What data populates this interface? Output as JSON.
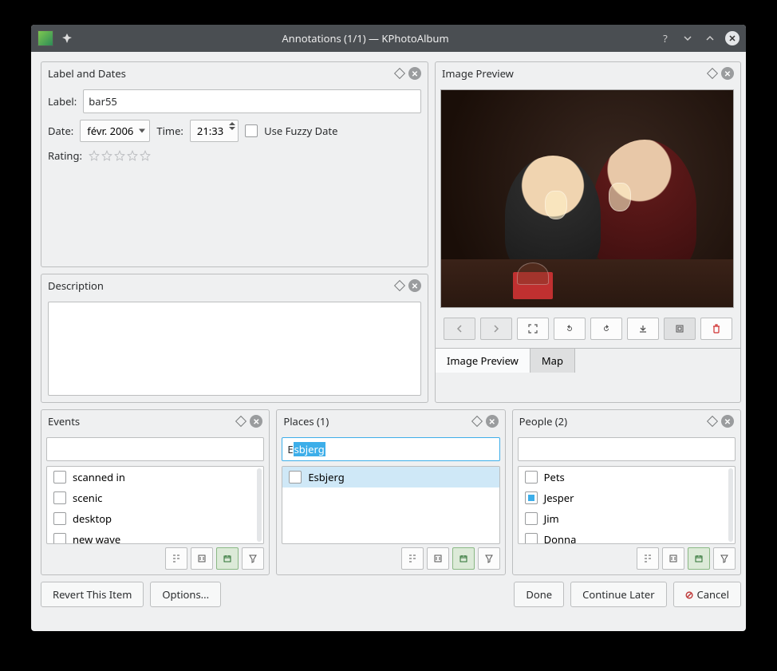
{
  "window": {
    "title": "Annotations (1/1) — KPhotoAlbum"
  },
  "panes": {
    "label_dates": {
      "title": "Label and Dates",
      "label_lbl": "Label:",
      "label_value": "bar55",
      "date_lbl": "Date:",
      "date_value": "févr. 2006",
      "time_lbl": "Time:",
      "time_value": "21:33",
      "fuzzy_lbl": "Use Fuzzy Date",
      "rating_lbl": "Rating:",
      "rating_value": 0
    },
    "description": {
      "title": "Description",
      "value": ""
    },
    "preview": {
      "title": "Image Preview",
      "tabs": {
        "preview": "Image Preview",
        "map": "Map"
      },
      "active_tab": "map"
    }
  },
  "categories": {
    "events": {
      "title": "Events",
      "filter": "",
      "items": [
        {
          "label": "scanned in",
          "checked": false
        },
        {
          "label": "scenic",
          "checked": false
        },
        {
          "label": "desktop",
          "checked": false
        },
        {
          "label": "new wave",
          "checked": false
        }
      ]
    },
    "places": {
      "title": "Places (1)",
      "filter_prefix": "E",
      "filter_sel": "sbjerg",
      "items": [
        {
          "label": "Esbjerg",
          "checked": false,
          "highlight": true
        }
      ]
    },
    "people": {
      "title": "People (2)",
      "filter": "",
      "items": [
        {
          "label": "Pets",
          "checked": false
        },
        {
          "label": "Jesper",
          "checked": true
        },
        {
          "label": "Jim",
          "checked": false
        },
        {
          "label": "Donna",
          "checked": false
        }
      ]
    }
  },
  "footer": {
    "revert": "Revert This Item",
    "options": "Options...",
    "done": "Done",
    "later": "Continue Later",
    "cancel": "Cancel"
  }
}
